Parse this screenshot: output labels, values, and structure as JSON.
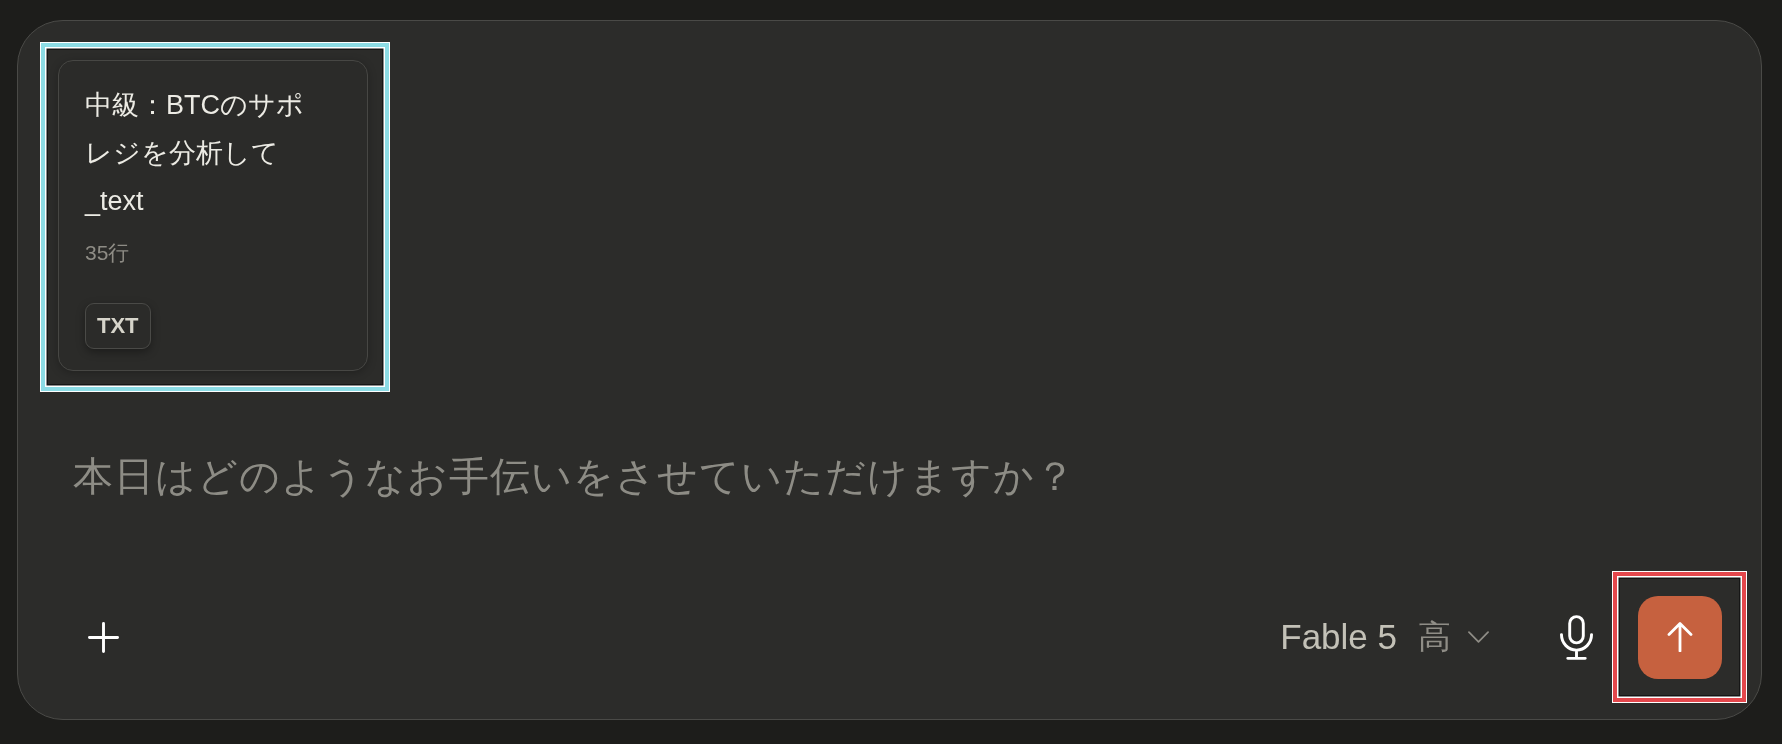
{
  "attachment": {
    "title": "中級：BTCのサポレジを分析して_text",
    "meta": "35行",
    "file_type": "TXT",
    "highlighted": true
  },
  "composer": {
    "placeholder": "本日はどのようなお手伝いをさせていただけますか？"
  },
  "toolbar": {
    "model": "Fable 5",
    "effort": "高"
  },
  "send_button": {
    "highlighted": true
  }
}
